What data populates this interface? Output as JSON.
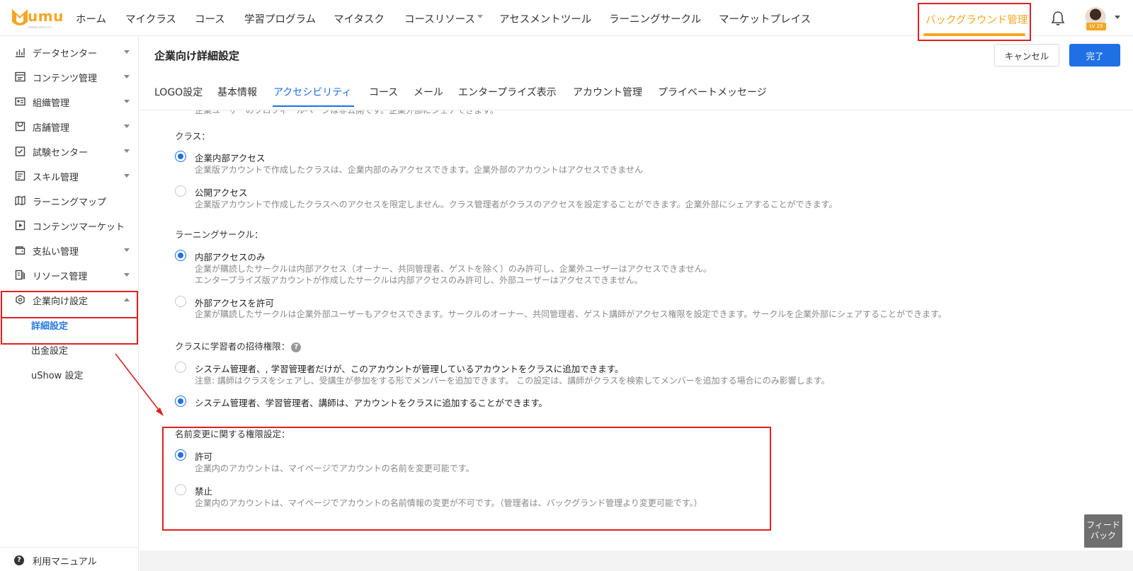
{
  "brand": {
    "logo_text": "umu",
    "logo_sub": "www.umu.co",
    "accent": "#f5a623",
    "primary": "#1f6fe5",
    "highlight": "#e02020"
  },
  "topnav": {
    "items": [
      "ホーム",
      "マイクラス",
      "コース",
      "学習プログラム",
      "マイタスク",
      "コースリソース",
      "アセスメントツール",
      "ラーニングサークル",
      "マーケットプレイス"
    ],
    "background_manage": "バックグラウンド管理",
    "user_level": "LV 25"
  },
  "sidebar": {
    "items": [
      {
        "label": "データセンター",
        "icon": "chart-icon",
        "arrow": "down"
      },
      {
        "label": "コンテンツ管理",
        "icon": "content-icon",
        "arrow": "down"
      },
      {
        "label": "組織管理",
        "icon": "id-card-icon",
        "arrow": "down"
      },
      {
        "label": "店舗管理",
        "icon": "store-icon",
        "arrow": "down"
      },
      {
        "label": "試験センター",
        "icon": "exam-icon",
        "arrow": "down"
      },
      {
        "label": "スキル管理",
        "icon": "skill-icon",
        "arrow": "down"
      },
      {
        "label": "ラーニングマップ",
        "icon": "map-icon",
        "arrow": ""
      },
      {
        "label": "コンテンツマーケット",
        "icon": "play-icon",
        "arrow": ""
      },
      {
        "label": "支払い管理",
        "icon": "wallet-icon",
        "arrow": "down"
      },
      {
        "label": "リソース管理",
        "icon": "resource-icon",
        "arrow": "down"
      },
      {
        "label": "企業向け設定",
        "icon": "settings-icon",
        "arrow": "up"
      }
    ],
    "sub_items": [
      {
        "label": "詳細設定",
        "active": true
      },
      {
        "label": "出金設定",
        "active": false
      },
      {
        "label": "uShow 設定",
        "active": false
      }
    ],
    "manual": "利用マニュアル"
  },
  "header": {
    "title": "企業向け詳細設定",
    "cancel": "キャンセル",
    "done": "完了"
  },
  "tabs": [
    "LOGO設定",
    "基本情報",
    "アクセシビリティ",
    "コース",
    "メール",
    "エンタープライズ表示",
    "アカウント管理",
    "プライベートメッセージ"
  ],
  "active_tab": 2,
  "content": {
    "cut_text": "企業ユーザーのプロフィールページは非公開です。企業外部にシェアできます。",
    "sections": [
      {
        "label": "クラス：",
        "options": [
          {
            "title": "企業内部アクセス",
            "desc": [
              "企業版アカウントで作成したクラスは、企業内部のみアクセスできます。企業外部のアカウントはアクセスできません"
            ],
            "checked": true
          },
          {
            "title": "公開アクセス",
            "desc": [
              "企業版アカウントで作成したクラスへのアクセスを限定しません。クラス管理者がクラスのアクセスを設定することができます。企業外部にシェアすることができます。"
            ],
            "checked": false
          }
        ]
      },
      {
        "label": "ラーニングサークル：",
        "options": [
          {
            "title": "内部アクセスのみ",
            "desc": [
              "企業が購読したサークルは内部アクセス（オーナー、共同管理者、ゲストを除く）のみ許可し、企業外ユーザーはアクセスできません。",
              "エンタープライズ版アカウントが作成したサークルは内部アクセスのみ許可し、外部ユーザーはアクセスできません。"
            ],
            "checked": true
          },
          {
            "title": "外部アクセスを許可",
            "desc": [
              "企業が購読したサークルは企業外部ユーザーもアクセスできます。サークルのオーナー、共同管理者、ゲスト講師がアクセス権限を設定できます。サークルを企業外部にシェアすることができます。"
            ],
            "checked": false
          }
        ]
      },
      {
        "label": "クラスに学習者の招待権限：",
        "help": "?",
        "options": [
          {
            "title": "システム管理者、, 学習管理者だけが、このアカウントが管理しているアカウントをクラスに追加できます。",
            "desc": [
              "注意: 講師はクラスをシェアし、受講生が参加をする形でメンバーを追加できます。 この設定は、講師がクラスを検索してメンバーを追加する場合にのみ影響します。"
            ],
            "checked": false
          },
          {
            "title": "システム管理者、学習管理者、講師は、アカウントをクラスに追加することができます。",
            "desc": [],
            "checked": true
          }
        ]
      },
      {
        "label": "名前変更に関する権限設定：",
        "options": [
          {
            "title": "許可",
            "desc": [
              "企業内のアカウントは、マイページでアカウントの名前を変更可能です。"
            ],
            "checked": true
          },
          {
            "title": "禁止",
            "desc": [
              "企業内のアカウントは、マイページでアカウントの名前情報の変更が不可です。（管理者は、バックグランド管理より変更可能です。）"
            ],
            "checked": false
          }
        ]
      }
    ]
  },
  "feedback": [
    "フィード",
    "バック"
  ]
}
